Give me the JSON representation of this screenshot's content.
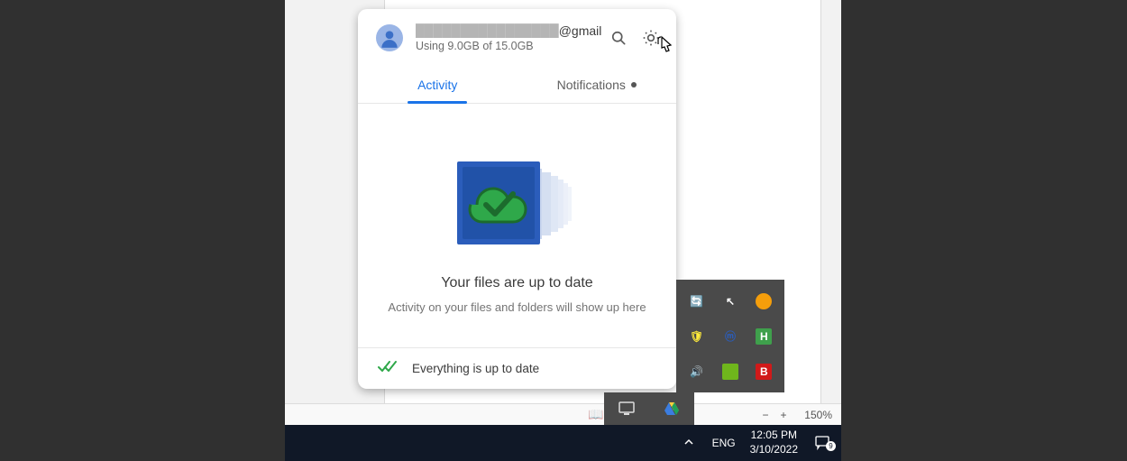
{
  "drive": {
    "email_hidden_part": "████████████████",
    "email_visible_suffix": "@gmail.c…",
    "storage_line": "Using 9.0GB of 15.0GB",
    "tabs": {
      "activity": "Activity",
      "notifications": "Notifications"
    },
    "headline": "Your files are up to date",
    "subtext": "Activity on your files and folders will show up here",
    "footer_status": "Everything is up to date"
  },
  "doc_bar": {
    "zoom": "150%"
  },
  "tray": {
    "items": [
      "drive-sync",
      "pointer",
      "browser",
      "security",
      "malware",
      "h-app",
      "sound",
      "nvidia",
      "b-app"
    ],
    "under": [
      "monitor",
      "google-drive"
    ]
  },
  "taskbar": {
    "lang": "ENG",
    "time": "12:05 PM",
    "date": "3/10/2022",
    "action_center_count": "9"
  }
}
